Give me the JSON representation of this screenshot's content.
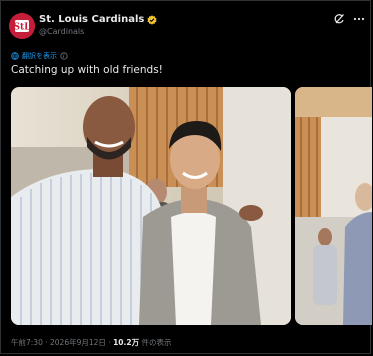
{
  "tweet": {
    "display_name": "St. Louis Cardinals",
    "handle": "@Cardinals",
    "translate_label": "翻訳を表示",
    "text": "Catching up with old friends!",
    "time": "午前7:30",
    "separator": "·",
    "date": "2026年9月12日",
    "views_count": "10.2万",
    "views_label": "件の表示"
  },
  "icons": {
    "avatar": "cardinals-logo",
    "verified": "verified-badge-icon",
    "refresh": "grok-icon",
    "more": "more-icon",
    "translate": "translate-globe-icon"
  },
  "colors": {
    "background": "#000000",
    "text": "#e7e9ea",
    "secondary": "#71767b",
    "link": "#1d9bf0",
    "verified": "#f4c430",
    "avatar": "#c41e3a"
  }
}
